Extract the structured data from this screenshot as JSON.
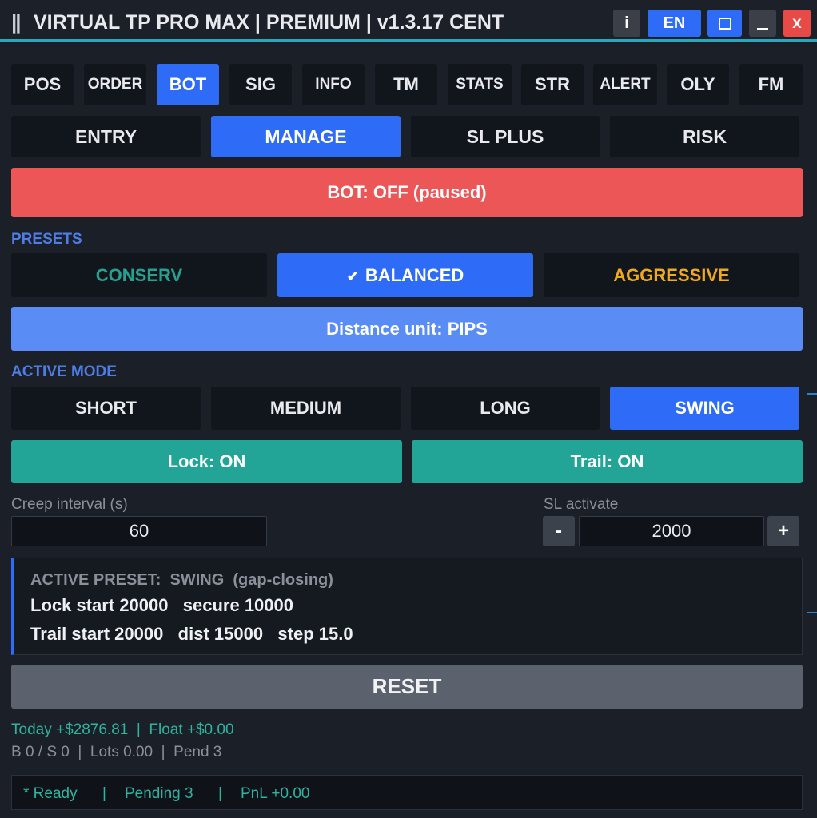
{
  "window": {
    "grip": "||",
    "title": "VIRTUAL TP PRO MAX | PREMIUM | v1.3.17  CENT",
    "info_label": "i",
    "lang_label": "EN",
    "close_label": "x"
  },
  "main_tabs": [
    {
      "label": "POS"
    },
    {
      "label": "ORDER"
    },
    {
      "label": "BOT"
    },
    {
      "label": "SIG"
    },
    {
      "label": "INFO"
    },
    {
      "label": "TM"
    },
    {
      "label": "STATS"
    },
    {
      "label": "STR"
    },
    {
      "label": "ALERT"
    },
    {
      "label": "OLY"
    },
    {
      "label": "FM"
    }
  ],
  "active_main_tab": "BOT",
  "sub_tabs": [
    {
      "label": "ENTRY"
    },
    {
      "label": "MANAGE"
    },
    {
      "label": "SL PLUS"
    },
    {
      "label": "RISK"
    }
  ],
  "active_sub_tab": "MANAGE",
  "bot_status": "BOT: OFF (paused)",
  "presets": {
    "section_label": "PRESETS",
    "items": [
      {
        "label": "CONSERV",
        "color": "#26a08f"
      },
      {
        "label": "BALANCED",
        "check": "✔",
        "color": "#ffffff"
      },
      {
        "label": "AGGRESSIVE",
        "color": "#f0a81c"
      }
    ],
    "selected": "BALANCED"
  },
  "distance_unit": "Distance unit: PIPS",
  "active_mode": {
    "section_label": "ACTIVE MODE",
    "items": [
      {
        "label": "SHORT"
      },
      {
        "label": "MEDIUM"
      },
      {
        "label": "LONG"
      },
      {
        "label": "SWING"
      }
    ],
    "selected": "SWING"
  },
  "toggles": {
    "lock": "Lock: ON",
    "trail": "Trail: ON"
  },
  "creep": {
    "label": "Creep interval (s)",
    "value": "60"
  },
  "sl_activate": {
    "label": "SL activate",
    "value": "2000",
    "minus": "-",
    "plus": "+"
  },
  "active_preset": {
    "heading": "ACTIVE PRESET:  SWING  (gap-closing)",
    "line1": "Lock start 20000   secure 10000",
    "line2": "Trail start 20000   dist 15000   step 15.0"
  },
  "reset_label": "RESET",
  "stats": {
    "line1": "Today +$2876.81  |  Float +$0.00",
    "line2": "B 0 / S 0  |  Lots 0.00  |  Pend 3"
  },
  "footer": {
    "ready": "* Ready",
    "sep": "|",
    "pending": "Pending 3",
    "pnl": "PnL +0.00"
  },
  "colors": {
    "accent": "#2e6bf6",
    "danger": "#ec5656",
    "success": "#22a596",
    "teal_text": "#2fb39f"
  }
}
